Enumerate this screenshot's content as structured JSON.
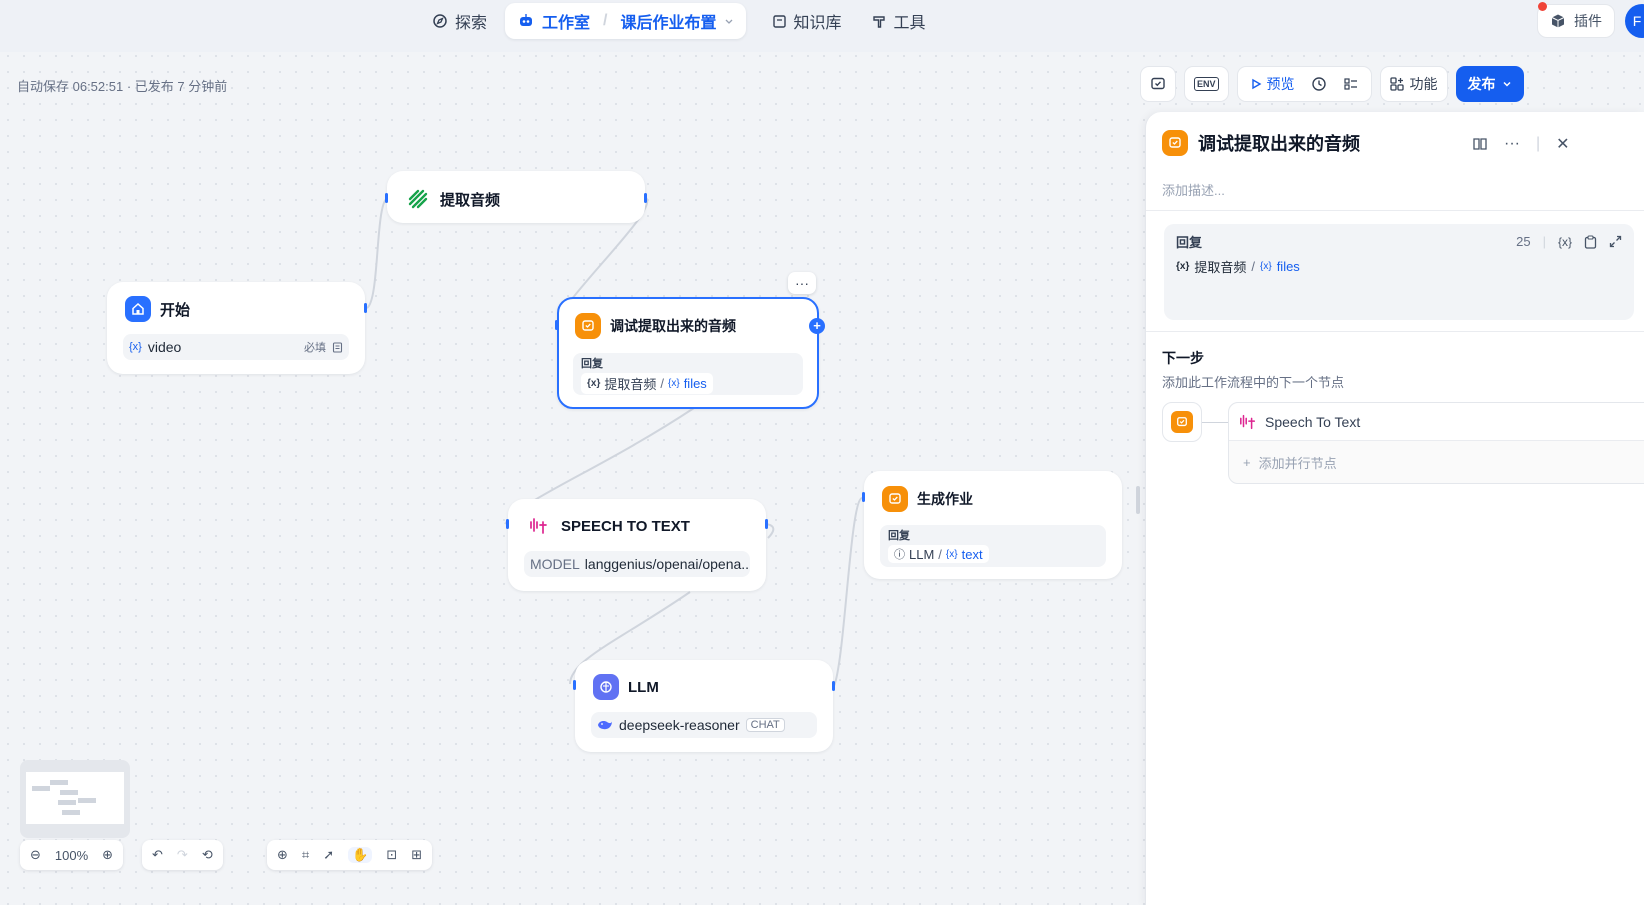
{
  "nav": {
    "explore": "探索",
    "studio": "工作室",
    "app_name": "课后作业布置",
    "knowledge": "知识库",
    "tools": "工具",
    "plugins": "插件",
    "avatar_initial": "F"
  },
  "status": {
    "autosave": "自动保存 06:52:51 · 已发布 7 分钟前"
  },
  "toolbar": {
    "preview": "预览",
    "features": "功能",
    "publish": "发布",
    "env": "ENV"
  },
  "nodes": {
    "start": {
      "title": "开始",
      "var": "video",
      "required": "必填"
    },
    "extract": {
      "title": "提取音频"
    },
    "debug": {
      "title": "调试提取出来的音频",
      "reply_label": "回复",
      "ref_node": "提取音频",
      "ref_var": "files"
    },
    "stt": {
      "title": "SPEECH TO TEXT",
      "model_label": "MODEL",
      "model": "langgenius/openai/opena..."
    },
    "llm": {
      "title": "LLM",
      "model": "deepseek-reasoner",
      "mode": "CHAT"
    },
    "homework": {
      "title": "生成作业",
      "reply_label": "回复",
      "ref_node": "LLM",
      "ref_var": "text"
    }
  },
  "panel": {
    "title": "调试提取出来的音频",
    "desc_placeholder": "添加描述...",
    "reply_label": "回复",
    "reply_count": "25",
    "ref_node": "提取音频",
    "ref_var": "files",
    "next_title": "下一步",
    "next_desc": "添加此工作流程中的下一个节点",
    "next_node": "Speech To Text",
    "add_parallel": "添加并行节点"
  },
  "zoom": {
    "level": "100%"
  },
  "colors": {
    "accent": "#155eef",
    "answer": "#f79009",
    "llm": "#6172f3",
    "stt": "#dd2590"
  }
}
